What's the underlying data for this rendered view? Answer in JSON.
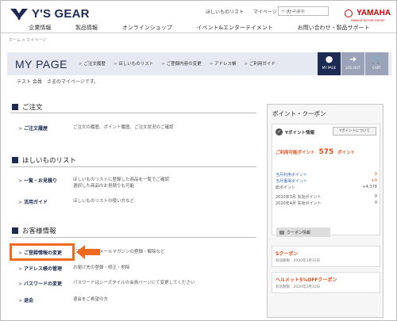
{
  "header": {
    "logo": "Y'S GEAR",
    "links": [
      "ほしいものリスト",
      "マイページ",
      "カート"
    ],
    "search_placeholder": "サイト内検索",
    "brand": "YAMAHA",
    "brand_sub": "YAMAHA MOTOR GROUP"
  },
  "gnav": [
    "企業情報",
    "製品情報",
    "オンラインショップ",
    "イベント&エンターテイメント",
    "お問い合わせ・製品サポート"
  ],
  "breadcrumb": "ホーム > マイページ",
  "mypage": {
    "title": "MY PAGE",
    "subnav": [
      "ご注文履歴",
      "ほしいものリスト",
      "ご登録内容の変更",
      "アドレス帳",
      "ご利用ガイド"
    ],
    "buttons": [
      "MY PAGE",
      "LOG OUT",
      "CART"
    ],
    "welcome": "テスト 会員　さまのマイページです。"
  },
  "sections": [
    {
      "title": "ご注文",
      "rows": [
        {
          "label": "ご注文履歴",
          "desc": "ご注文の履歴、ポイント履歴、ご注文状況のご確認"
        }
      ]
    },
    {
      "title": "ほしいものリスト",
      "rows": [
        {
          "label": "一覧・お見積り",
          "desc": "ほしいものリストに登録した商品を一覧でご確認\n選択した商品のお見積りも可能"
        },
        {
          "label": "活用ガイド",
          "desc": "ほしいものリストの使い方など"
        }
      ]
    },
    {
      "title": "お客様情報",
      "rows": [
        {
          "label": "ご登録情報の変更",
          "desc": "ご登録内容、メールマガジンの登録・解除など"
        },
        {
          "label": "アドレス帳の管理",
          "desc": "お届け先の登録・修正・削除"
        },
        {
          "label": "パスワードの変更",
          "desc": "パスワードはシーズタイルの会員ページにて変更してください"
        },
        {
          "label": "退会",
          "desc": "退会をご希望の方"
        }
      ]
    }
  ],
  "points": {
    "title": "ポイント・クーポン",
    "y_label": "Yポイント情報",
    "y_button": "Yポイントについて",
    "available_label": "ご利用可能ポイント",
    "available_value": "575",
    "available_unit": "ポイント",
    "lines": [
      {
        "label": "当月利用ポイント",
        "value": "0",
        "style": "u"
      },
      {
        "label": "当月獲得ポイント",
        "value": "+0",
        "style": "u"
      },
      {
        "label": "総ポイント",
        "value": "+4,378",
        "style": "plain"
      },
      {
        "label": "2020年3月 失効ポイント",
        "value": "0",
        "style": "plain"
      },
      {
        "label": "2020年4月 失効ポイント",
        "value": "0",
        "style": "plain"
      }
    ],
    "coupon_header": "クーポン情報",
    "coupons": [
      {
        "name": "Sクーポン",
        "date": "有効期限：2020年3月31日"
      },
      {
        "name": "ヘルメット5%OFFクーポン",
        "date": "有効期限：2020年3月31日"
      }
    ]
  },
  "colors": {
    "navy": "#1d2a52",
    "orange": "#ee6a1f",
    "red": "#e24c1a"
  }
}
